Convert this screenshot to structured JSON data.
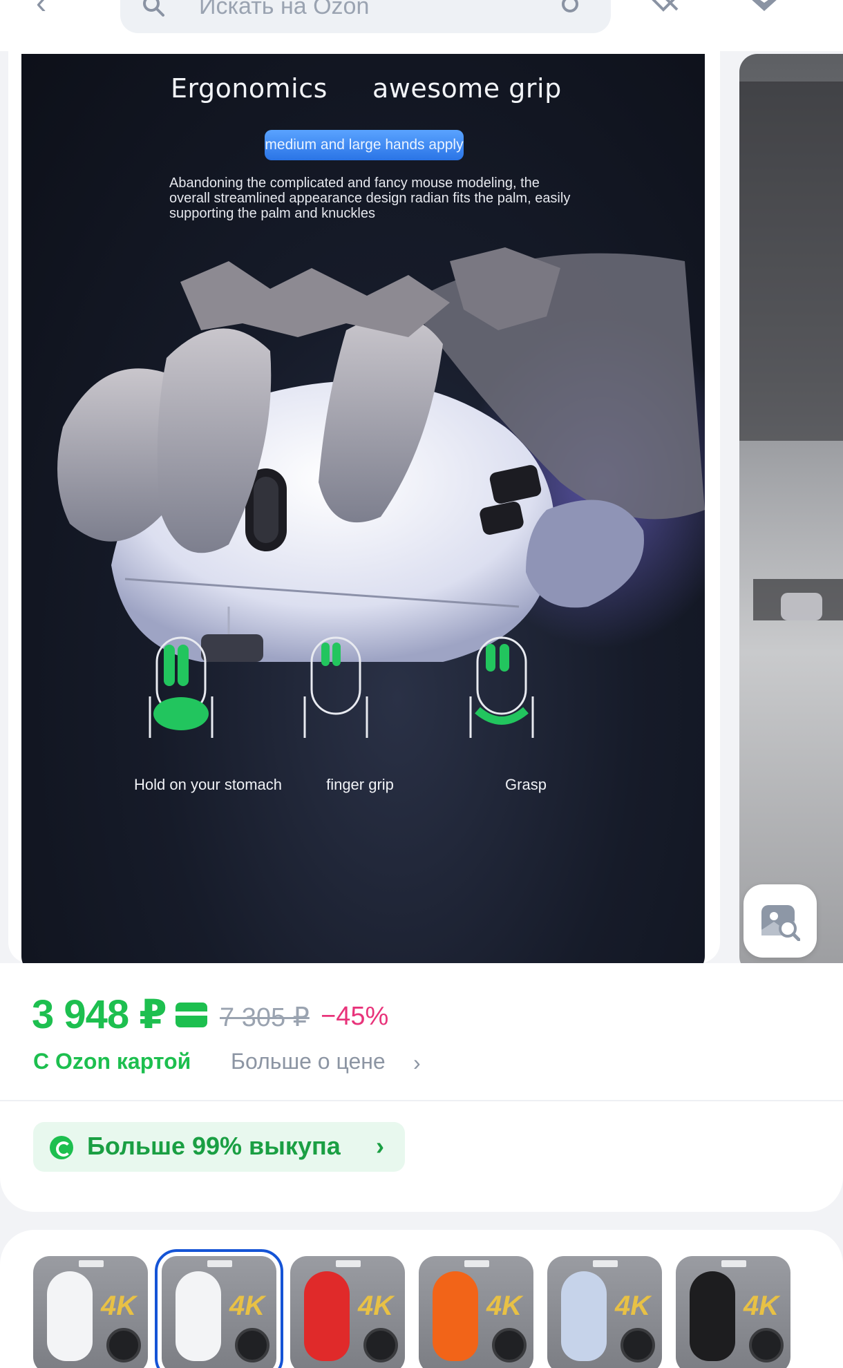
{
  "topbar": {
    "search_placeholder": "Искать на Ozon"
  },
  "hero": {
    "heading_left": "Ergonomics",
    "heading_right": "awesome grip",
    "badge": "medium and large hands apply",
    "description": "Abandoning the complicated and fancy mouse modeling, the overall streamlined appearance design radian fits the palm, easily supporting the palm and knuckles",
    "grips": [
      {
        "label": "Hold on your stomach"
      },
      {
        "label": "finger grip"
      },
      {
        "label": "Grasp"
      }
    ]
  },
  "price": {
    "current": "3 948 ₽",
    "old": "7 305 ₽",
    "discount": "−45%",
    "with_card": "С Ozon картой",
    "more": "Больше о цене"
  },
  "buyout": {
    "label": "Больше 99% выкупа"
  },
  "variants": [
    {
      "color": "#f3f4f6",
      "label": "4K",
      "selected": false
    },
    {
      "color": "#f3f4f6",
      "label": "4K",
      "selected": true
    },
    {
      "color": "#e02a2a",
      "label": "4K",
      "selected": false
    },
    {
      "color": "#f26418",
      "label": "4K",
      "selected": false
    },
    {
      "color": "#c6d3ea",
      "label": "4K",
      "selected": false
    },
    {
      "color": "#1d1d1f",
      "label": "4K",
      "selected": false
    }
  ],
  "colors": {
    "accent_green": "#1dbf4f",
    "discount_pink": "#e8337a",
    "selection_blue": "#1554d6"
  }
}
